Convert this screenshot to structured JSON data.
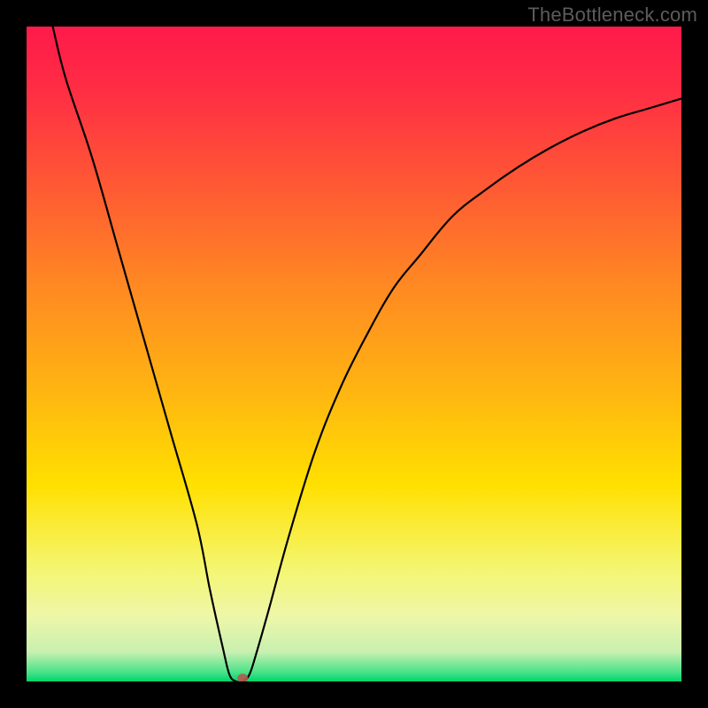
{
  "watermark": "TheBottleneck.com",
  "chart_data": {
    "type": "line",
    "title": "",
    "xlabel": "",
    "ylabel": "",
    "xlim": [
      0,
      100
    ],
    "ylim": [
      0,
      100
    ],
    "curve": [
      {
        "x": 4.0,
        "y": 100.0
      },
      {
        "x": 6.0,
        "y": 92.0
      },
      {
        "x": 10.0,
        "y": 80.0
      },
      {
        "x": 14.0,
        "y": 66.0
      },
      {
        "x": 18.0,
        "y": 52.0
      },
      {
        "x": 22.0,
        "y": 38.0
      },
      {
        "x": 26.0,
        "y": 24.0
      },
      {
        "x": 28.0,
        "y": 14.0
      },
      {
        "x": 30.0,
        "y": 5.0
      },
      {
        "x": 31.0,
        "y": 1.0
      },
      {
        "x": 32.0,
        "y": 0.0
      },
      {
        "x": 33.0,
        "y": 0.0
      },
      {
        "x": 34.0,
        "y": 1.0
      },
      {
        "x": 35.0,
        "y": 4.0
      },
      {
        "x": 37.0,
        "y": 11.0
      },
      {
        "x": 40.0,
        "y": 22.0
      },
      {
        "x": 44.0,
        "y": 35.0
      },
      {
        "x": 48.0,
        "y": 45.0
      },
      {
        "x": 52.0,
        "y": 53.0
      },
      {
        "x": 56.0,
        "y": 60.0
      },
      {
        "x": 60.0,
        "y": 65.0
      },
      {
        "x": 65.0,
        "y": 71.0
      },
      {
        "x": 70.0,
        "y": 75.0
      },
      {
        "x": 75.0,
        "y": 78.5
      },
      {
        "x": 80.0,
        "y": 81.5
      },
      {
        "x": 85.0,
        "y": 84.0
      },
      {
        "x": 90.0,
        "y": 86.0
      },
      {
        "x": 95.0,
        "y": 87.5
      },
      {
        "x": 100.0,
        "y": 89.0
      }
    ],
    "marker": {
      "x": 33.0,
      "y": 0.5
    },
    "background_gradient": {
      "stops": [
        {
          "offset": 0.0,
          "color": "#ff1a4a"
        },
        {
          "offset": 0.1,
          "color": "#ff2e44"
        },
        {
          "offset": 0.25,
          "color": "#ff5b33"
        },
        {
          "offset": 0.4,
          "color": "#ff8a22"
        },
        {
          "offset": 0.55,
          "color": "#ffb312"
        },
        {
          "offset": 0.7,
          "color": "#ffe000"
        },
        {
          "offset": 0.82,
          "color": "#f5f56a"
        },
        {
          "offset": 0.9,
          "color": "#eef7a8"
        },
        {
          "offset": 0.955,
          "color": "#c8f0b0"
        },
        {
          "offset": 0.985,
          "color": "#4de38a"
        },
        {
          "offset": 1.0,
          "color": "#00d56a"
        }
      ]
    }
  }
}
